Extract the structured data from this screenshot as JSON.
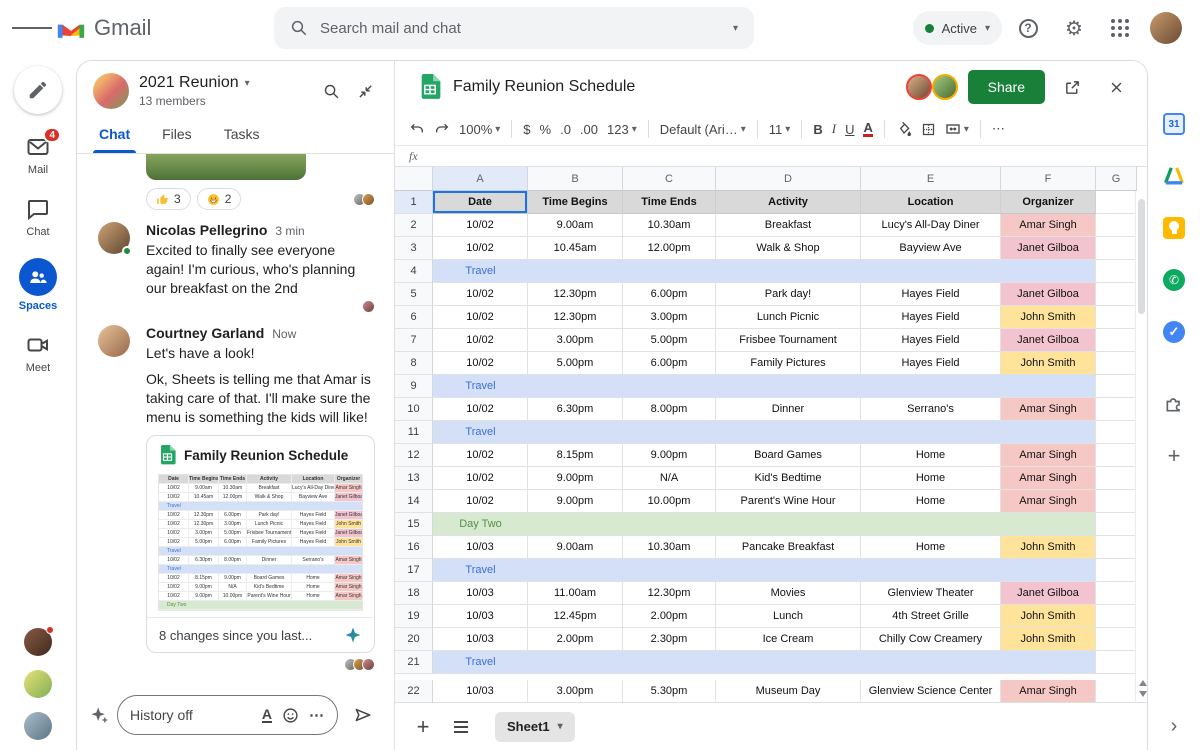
{
  "topbar": {
    "app_name": "Gmail",
    "search_placeholder": "Search mail and chat",
    "status_label": "Active"
  },
  "left_rail": {
    "items": [
      {
        "id": "mail",
        "label": "Mail",
        "badge": "4"
      },
      {
        "id": "chat",
        "label": "Chat"
      },
      {
        "id": "spaces",
        "label": "Spaces"
      },
      {
        "id": "meet",
        "label": "Meet"
      }
    ]
  },
  "space_panel": {
    "title": "2021 Reunion",
    "members": "13 members",
    "tabs": [
      {
        "label": "Chat"
      },
      {
        "label": "Files"
      },
      {
        "label": "Tasks"
      }
    ],
    "reactions": [
      {
        "icon": "thumbs-up",
        "count": "3"
      },
      {
        "icon": "laughing-face",
        "count": "2"
      }
    ],
    "messages": [
      {
        "sender": "Nicolas Pellegrino",
        "time": "3 min",
        "lines": [
          "Excited to finally see everyone again! I'm curious, who's planning our breakfast on the 2nd"
        ]
      },
      {
        "sender": "Courtney Garland",
        "time": "Now",
        "lines": [
          "Let's have a look!",
          "Ok, Sheets is telling me that Amar is taking care of that. I'll make sure the menu is something the kids will like!"
        ]
      }
    ],
    "file_card": {
      "title": "Family Reunion Schedule",
      "footer": "8 changes since you last..."
    },
    "composer": {
      "placeholder": "History off"
    }
  },
  "sheets": {
    "title": "Family Reunion Schedule",
    "share_label": "Share",
    "toolbar": {
      "zoom": "100%",
      "currency": "$",
      "percent": "%",
      "dec_down": ".0",
      "dec_up": ".00",
      "more_formats": "123",
      "font": "Default (Ari…",
      "font_size": "11",
      "bold": "B",
      "italic": "I",
      "underline": "U",
      "text_color": "A",
      "more": "⋯"
    },
    "formula_label": "fx",
    "grid": {
      "columns": [
        "A",
        "B",
        "C",
        "D",
        "E",
        "F",
        "G"
      ],
      "header": [
        "Date",
        "Time Begins",
        "Time Ends",
        "Activity",
        "Location",
        "Organizer"
      ],
      "organizer_colors": {
        "Amar Singh": "#f6c8c5",
        "Janet Gilboa": "#f3c3cf",
        "John Smith": "#ffe39a"
      },
      "band_colors": {
        "travel_bg": "#d3e0f8",
        "travel_text": "#3e6fd8",
        "day_bg": "#d8e9d2",
        "day_text": "#569141"
      },
      "rows": [
        {
          "n": 2,
          "cells": [
            "10/02",
            "9.00am",
            "10.30am",
            "Breakfast",
            "Lucy's All-Day Diner",
            "Amar Singh"
          ]
        },
        {
          "n": 3,
          "cells": [
            "10/02",
            "10.45am",
            "12.00pm",
            "Walk & Shop",
            "Bayview Ave",
            "Janet Gilboa"
          ]
        },
        {
          "n": 4,
          "band": "travel",
          "label": "Travel"
        },
        {
          "n": 5,
          "cells": [
            "10/02",
            "12.30pm",
            "6.00pm",
            "Park day!",
            "Hayes Field",
            "Janet Gilboa"
          ]
        },
        {
          "n": 6,
          "cells": [
            "10/02",
            "12.30pm",
            "3.00pm",
            "Lunch Picnic",
            "Hayes Field",
            "John Smith"
          ]
        },
        {
          "n": 7,
          "cells": [
            "10/02",
            "3.00pm",
            "5.00pm",
            "Frisbee Tournament",
            "Hayes Field",
            "Janet Gilboa"
          ]
        },
        {
          "n": 8,
          "cells": [
            "10/02",
            "5.00pm",
            "6.00pm",
            "Family Pictures",
            "Hayes Field",
            "John Smith"
          ]
        },
        {
          "n": 9,
          "band": "travel",
          "label": "Travel"
        },
        {
          "n": 10,
          "cells": [
            "10/02",
            "6.30pm",
            "8.00pm",
            "Dinner",
            "Serrano's",
            "Amar Singh"
          ]
        },
        {
          "n": 11,
          "band": "travel",
          "label": "Travel"
        },
        {
          "n": 12,
          "cells": [
            "10/02",
            "8.15pm",
            "9.00pm",
            "Board Games",
            "Home",
            "Amar Singh"
          ]
        },
        {
          "n": 13,
          "cells": [
            "10/02",
            "9.00pm",
            "N/A",
            "Kid's Bedtime",
            "Home",
            "Amar Singh"
          ]
        },
        {
          "n": 14,
          "cells": [
            "10/02",
            "9.00pm",
            "10.00pm",
            "Parent's Wine Hour",
            "Home",
            "Amar Singh"
          ]
        },
        {
          "n": 15,
          "band": "day",
          "label": "Day Two"
        },
        {
          "n": 16,
          "cells": [
            "10/03",
            "9.00am",
            "10.30am",
            "Pancake Breakfast",
            "Home",
            "John Smith"
          ]
        },
        {
          "n": 17,
          "band": "travel",
          "label": "Travel"
        },
        {
          "n": 18,
          "cells": [
            "10/03",
            "11.00am",
            "12.30pm",
            "Movies",
            "Glenview Theater",
            "Janet Gilboa"
          ]
        },
        {
          "n": 19,
          "cells": [
            "10/03",
            "12.45pm",
            "2.00pm",
            "Lunch",
            "4th Street Grille",
            "John Smith"
          ]
        },
        {
          "n": 20,
          "cells": [
            "10/03",
            "2.00pm",
            "2.30pm",
            "Ice Cream",
            "Chilly Cow Creamery",
            "John Smith"
          ]
        },
        {
          "n": 21,
          "band": "travel",
          "label": "Travel"
        },
        {
          "n": 22,
          "cells": [
            "10/03",
            "3.00pm",
            "5.30pm",
            "Museum Day",
            "Glenview Science Center",
            "Amar Singh"
          ]
        }
      ]
    },
    "bottom_bar": {
      "sheet_tab": "Sheet1"
    }
  },
  "right_rail": {
    "calendar_label": "31",
    "tasks_check": "✓"
  }
}
